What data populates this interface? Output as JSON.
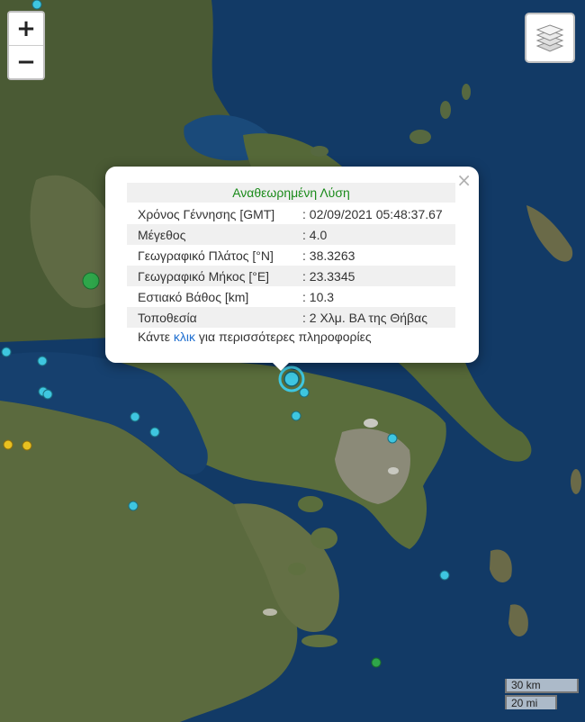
{
  "map": {
    "base_layer": "satellite"
  },
  "controls": {
    "zoom_in_label": "+",
    "zoom_out_label": "−",
    "layers_icon": "layers-icon"
  },
  "popup": {
    "close_label": "×",
    "title": "Αναθεωρημένη Λύση",
    "rows": [
      {
        "label": "Χρόνος Γέννησης [GMT]",
        "value": ": 02/09/2021 05:48:37.67"
      },
      {
        "label": "Μέγεθος",
        "value": ": 4.0"
      },
      {
        "label": "Γεωγραφικό Πλάτος [°N]",
        "value": ": 38.3263"
      },
      {
        "label": "Γεωγραφικό Μήκος [°E]",
        "value": ": 23.3345"
      },
      {
        "label": "Εστιακό Βάθος [km]",
        "value": ": 10.3"
      },
      {
        "label": "Τοποθεσία",
        "value": ": 2 Χλμ. ΒΑ της Θήβας"
      }
    ],
    "footer_prefix": "Κάντε ",
    "footer_link": "κλικ",
    "footer_suffix": " για περισσότερες πληροφορίες"
  },
  "scale": {
    "km_label": "30 km",
    "mi_label": "20 mi"
  },
  "marker_colors": {
    "cyan": "#3ec6e0",
    "yellow": "#e8c020",
    "green": "#2ea64a"
  }
}
